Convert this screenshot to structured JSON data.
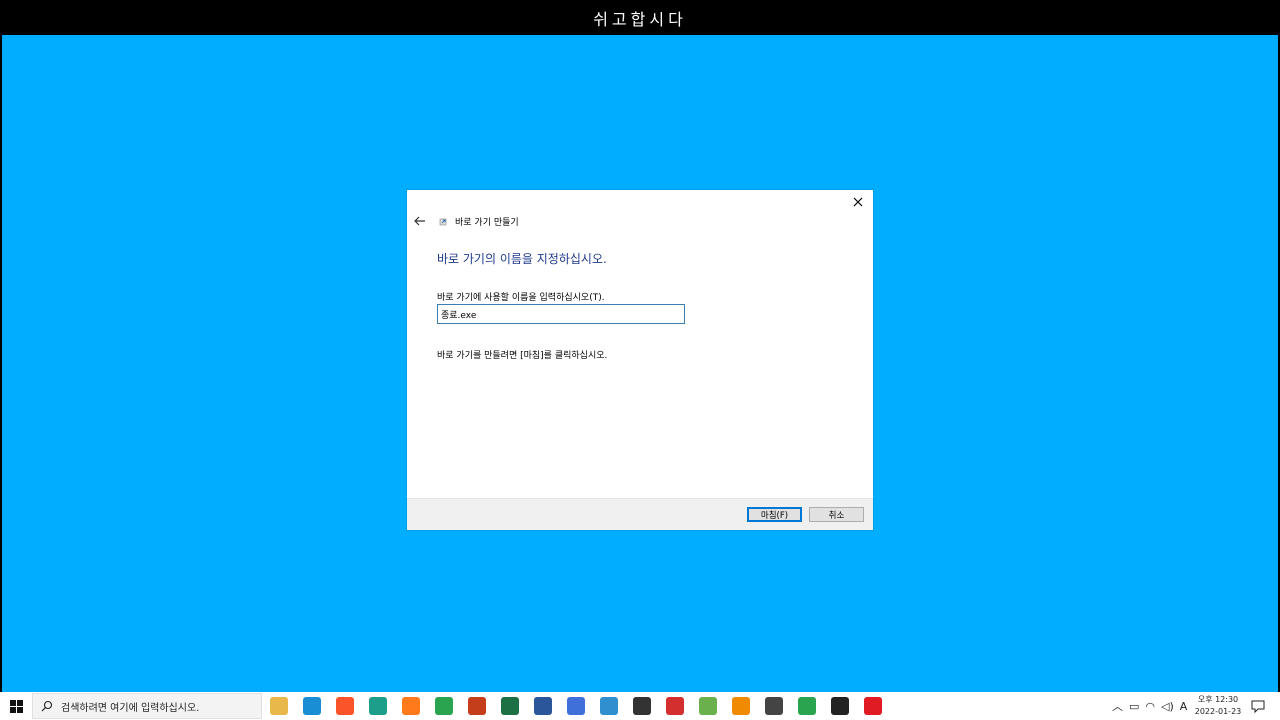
{
  "banner": {
    "text": "쉬고합시다"
  },
  "dialog": {
    "wizard_title": "바로 가기 만들기",
    "heading": "바로 가기의 이름을 지정하십시오.",
    "prompt_label": "바로 가기에 사용할 이름을 입력하십시오(T).",
    "name_value": "종료.exe",
    "finish_hint": "바로 가기를 만들려면 [마침]를 클릭하십시오.",
    "finish_label": "마침(F)",
    "cancel_label": "취소"
  },
  "taskbar": {
    "search_placeholder": "검색하려면 여기에 입력하십시오.",
    "apps": [
      {
        "name": "file-explorer-icon",
        "color": "#e8b84a"
      },
      {
        "name": "edge-icon",
        "color": "#1a8ed4"
      },
      {
        "name": "brave-icon",
        "color": "#fb542b"
      },
      {
        "name": "app-teal-icon",
        "color": "#1c9e8a"
      },
      {
        "name": "firefox-icon",
        "color": "#ff7a1a"
      },
      {
        "name": "chrome-icon",
        "color": "#2aa44f"
      },
      {
        "name": "powerpoint-icon",
        "color": "#c43e1c"
      },
      {
        "name": "excel-icon",
        "color": "#1d7044"
      },
      {
        "name": "word-icon",
        "color": "#2b579a"
      },
      {
        "name": "app-blue-icon",
        "color": "#3f6fd8"
      },
      {
        "name": "app-monitor-icon",
        "color": "#2f8fcf"
      },
      {
        "name": "search-tool-icon",
        "color": "#333333"
      },
      {
        "name": "app-se-icon",
        "color": "#d32f2f"
      },
      {
        "name": "app-green-icon",
        "color": "#6ab04c"
      },
      {
        "name": "vlc-icon",
        "color": "#f08a00"
      },
      {
        "name": "calculator-icon",
        "color": "#444444"
      },
      {
        "name": "chrome-alt-icon",
        "color": "#2aa44f"
      },
      {
        "name": "sticky-notes-icon",
        "color": "#222222"
      },
      {
        "name": "opera-icon",
        "color": "#e01b24"
      }
    ],
    "ime_indicator": "A",
    "clock_time": "오후 12:30",
    "clock_date": "2022-01-23"
  }
}
